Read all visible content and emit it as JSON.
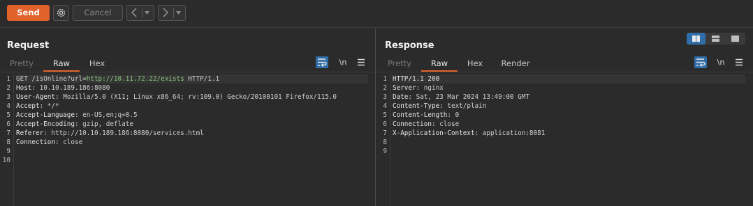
{
  "toolbar": {
    "send_label": "Send",
    "cancel_label": "Cancel"
  },
  "request": {
    "title": "Request",
    "tabs": [
      "Pretty",
      "Raw",
      "Hex"
    ],
    "active_tab": "Raw",
    "newline_label": "\\n",
    "line_numbers": [
      "1",
      "2",
      "3",
      "4",
      "5",
      "6",
      "7",
      "8",
      "9",
      "10"
    ],
    "lines": [
      {
        "pre": "GET /isOnline?url=",
        "url": "http://10.11.72.22/exists",
        "post": " HTTP/1.1"
      },
      {
        "key": "Host",
        "value": " 10.10.189.186:8080"
      },
      {
        "key": "User-Agent",
        "value": " Mozilla/5.0 (X11; Linux x86_64; rv:109.0) Gecko/20100101 Firefox/115.0"
      },
      {
        "key": "Accept",
        "value": " */*"
      },
      {
        "key": "Accept-Language",
        "value": " en-US,en;q=0.5"
      },
      {
        "key": "Accept-Encoding",
        "value": " gzip, deflate"
      },
      {
        "key": "Referer",
        "value": " http://10.10.189.186:8080/services.html"
      },
      {
        "key": "Connection",
        "value": " close"
      }
    ]
  },
  "response": {
    "title": "Response",
    "tabs": [
      "Pretty",
      "Raw",
      "Hex",
      "Render"
    ],
    "active_tab": "Raw",
    "newline_label": "\\n",
    "line_numbers": [
      "1",
      "2",
      "3",
      "4",
      "5",
      "6",
      "7",
      "8",
      "9"
    ],
    "lines": [
      {
        "pre": "HTTP/1.1 200"
      },
      {
        "key": "Server",
        "value": " nginx"
      },
      {
        "key": "Date",
        "value": " Sat, 23 Mar 2024 13:49:00 GMT"
      },
      {
        "key": "Content-Type",
        "value": " text/plain"
      },
      {
        "key": "Content-Length",
        "value": " 0"
      },
      {
        "key": "Connection",
        "value": " close"
      },
      {
        "key": "X-Application-Context",
        "value": " application:8081"
      }
    ]
  },
  "colors": {
    "accent": "#e2622b",
    "active_icon": "#2f6ea8",
    "url": "#8ac77c"
  }
}
